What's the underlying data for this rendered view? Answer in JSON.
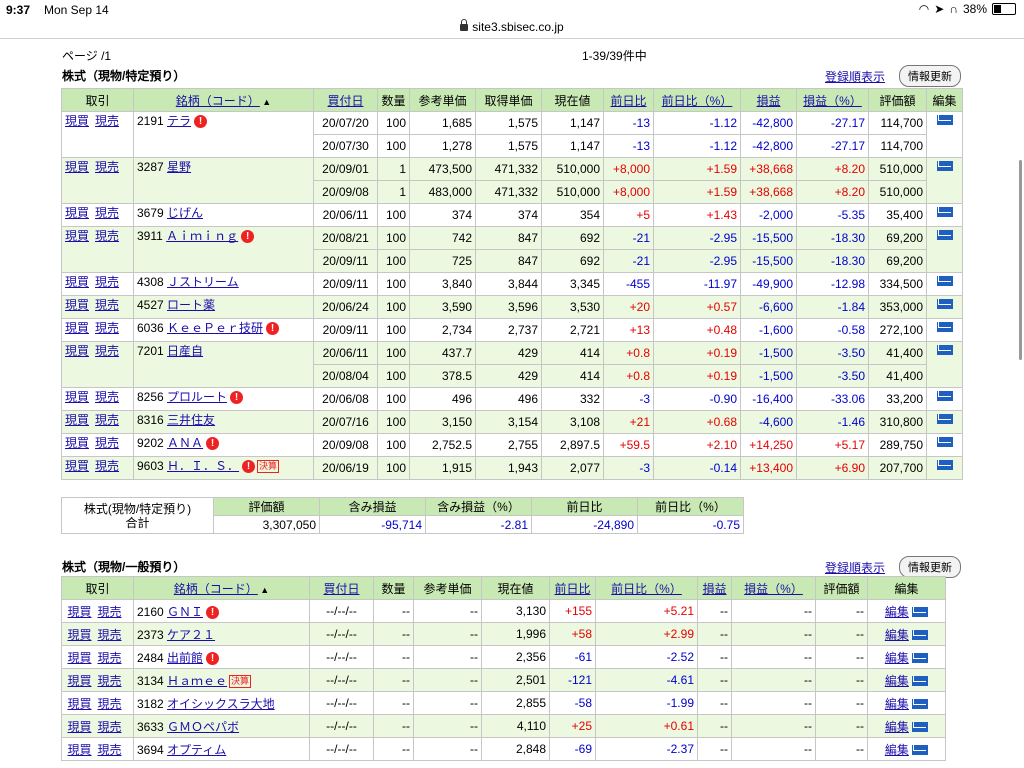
{
  "status": {
    "time": "9:37",
    "date": "Mon Sep 14",
    "battery": "38%"
  },
  "url": "site3.sbisec.co.jp",
  "page": {
    "label": "ページ /1",
    "count": "1-39/39件中"
  },
  "tools": {
    "sort_link": "登録順表示",
    "refresh_button": "情報更新"
  },
  "section1": {
    "title": "株式（現物/特定預り）",
    "headers": [
      "取引",
      "銘柄（コード）",
      "買付日",
      "数量",
      "参考単価",
      "取得単価",
      "現在値",
      "前日比",
      "前日比（%）",
      "損益",
      "損益（%）",
      "評価額",
      "編集"
    ],
    "buy": "現買",
    "sell": "現売",
    "rows": [
      {
        "code": "2191",
        "name": "テラ",
        "badge": "warn",
        "lots": [
          {
            "date": "20/07/20",
            "qty": "100",
            "ref": "1,685",
            "cost": "1,575",
            "price": "1,147",
            "chg": "-13",
            "chgp": "-1.12",
            "pl": "-42,800",
            "plp": "-27.17",
            "val": "114,700"
          },
          {
            "date": "20/07/30",
            "qty": "100",
            "ref": "1,278",
            "cost": "1,575",
            "price": "1,147",
            "chg": "-13",
            "chgp": "-1.12",
            "pl": "-42,800",
            "plp": "-27.17",
            "val": "114,700"
          }
        ]
      },
      {
        "code": "3287",
        "name": "星野",
        "badge": "",
        "lots": [
          {
            "date": "20/09/01",
            "qty": "1",
            "ref": "473,500",
            "cost": "471,332",
            "price": "510,000",
            "chg": "+8,000",
            "chgp": "+1.59",
            "pl": "+38,668",
            "plp": "+8.20",
            "val": "510,000"
          },
          {
            "date": "20/09/08",
            "qty": "1",
            "ref": "483,000",
            "cost": "471,332",
            "price": "510,000",
            "chg": "+8,000",
            "chgp": "+1.59",
            "pl": "+38,668",
            "plp": "+8.20",
            "val": "510,000"
          }
        ]
      },
      {
        "code": "3679",
        "name": "じげん",
        "badge": "",
        "lots": [
          {
            "date": "20/06/11",
            "qty": "100",
            "ref": "374",
            "cost": "374",
            "price": "354",
            "chg": "+5",
            "chgp": "+1.43",
            "pl": "-2,000",
            "plp": "-5.35",
            "val": "35,400"
          }
        ]
      },
      {
        "code": "3911",
        "name": "Ａｉｍｉｎｇ",
        "badge": "warn",
        "lots": [
          {
            "date": "20/08/21",
            "qty": "100",
            "ref": "742",
            "cost": "847",
            "price": "692",
            "chg": "-21",
            "chgp": "-2.95",
            "pl": "-15,500",
            "plp": "-18.30",
            "val": "69,200"
          },
          {
            "date": "20/09/11",
            "qty": "100",
            "ref": "725",
            "cost": "847",
            "price": "692",
            "chg": "-21",
            "chgp": "-2.95",
            "pl": "-15,500",
            "plp": "-18.30",
            "val": "69,200"
          }
        ]
      },
      {
        "code": "4308",
        "name": "Ｊストリーム",
        "badge": "",
        "lots": [
          {
            "date": "20/09/11",
            "qty": "100",
            "ref": "3,840",
            "cost": "3,844",
            "price": "3,345",
            "chg": "-455",
            "chgp": "-11.97",
            "pl": "-49,900",
            "plp": "-12.98",
            "val": "334,500"
          }
        ]
      },
      {
        "code": "4527",
        "name": "ロート薬",
        "badge": "",
        "lots": [
          {
            "date": "20/06/24",
            "qty": "100",
            "ref": "3,590",
            "cost": "3,596",
            "price": "3,530",
            "chg": "+20",
            "chgp": "+0.57",
            "pl": "-6,600",
            "plp": "-1.84",
            "val": "353,000"
          }
        ]
      },
      {
        "code": "6036",
        "name": "ＫｅｅＰｅｒ技研",
        "badge": "warn",
        "lots": [
          {
            "date": "20/09/11",
            "qty": "100",
            "ref": "2,734",
            "cost": "2,737",
            "price": "2,721",
            "chg": "+13",
            "chgp": "+0.48",
            "pl": "-1,600",
            "plp": "-0.58",
            "val": "272,100"
          }
        ]
      },
      {
        "code": "7201",
        "name": "日産自",
        "badge": "",
        "lots": [
          {
            "date": "20/06/11",
            "qty": "100",
            "ref": "437.7",
            "cost": "429",
            "price": "414",
            "chg": "+0.8",
            "chgp": "+0.19",
            "pl": "-1,500",
            "plp": "-3.50",
            "val": "41,400"
          },
          {
            "date": "20/08/04",
            "qty": "100",
            "ref": "378.5",
            "cost": "429",
            "price": "414",
            "chg": "+0.8",
            "chgp": "+0.19",
            "pl": "-1,500",
            "plp": "-3.50",
            "val": "41,400"
          }
        ]
      },
      {
        "code": "8256",
        "name": "プロルート",
        "badge": "warn",
        "lots": [
          {
            "date": "20/06/08",
            "qty": "100",
            "ref": "496",
            "cost": "496",
            "price": "332",
            "chg": "-3",
            "chgp": "-0.90",
            "pl": "-16,400",
            "plp": "-33.06",
            "val": "33,200"
          }
        ]
      },
      {
        "code": "8316",
        "name": "三井住友",
        "badge": "",
        "lots": [
          {
            "date": "20/07/16",
            "qty": "100",
            "ref": "3,150",
            "cost": "3,154",
            "price": "3,108",
            "chg": "+21",
            "chgp": "+0.68",
            "pl": "-4,600",
            "plp": "-1.46",
            "val": "310,800"
          }
        ]
      },
      {
        "code": "9202",
        "name": "ＡＮＡ",
        "badge": "warn",
        "lots": [
          {
            "date": "20/09/08",
            "qty": "100",
            "ref": "2,752.5",
            "cost": "2,755",
            "price": "2,897.5",
            "chg": "+59.5",
            "chgp": "+2.10",
            "pl": "+14,250",
            "plp": "+5.17",
            "val": "289,750"
          }
        ]
      },
      {
        "code": "9603",
        "name": "Ｈ．Ｉ．Ｓ．",
        "badge": "warn-kessan",
        "lots": [
          {
            "date": "20/06/19",
            "qty": "100",
            "ref": "1,915",
            "cost": "1,943",
            "price": "2,077",
            "chg": "-3",
            "chgp": "-0.14",
            "pl": "+13,400",
            "plp": "+6.90",
            "val": "207,700"
          }
        ]
      }
    ]
  },
  "summary": {
    "label": "株式(現物/特定預り)\n合計",
    "headers": [
      "評価額",
      "含み損益",
      "含み損益（%）",
      "前日比",
      "前日比（%）"
    ],
    "values": [
      "3,307,050",
      "-95,714",
      "-2.81",
      "-24,890",
      "-0.75"
    ]
  },
  "section2": {
    "title": "株式（現物/一般預り）",
    "headers": [
      "取引",
      "銘柄（コード）",
      "買付日",
      "数量",
      "参考単価",
      "現在値",
      "前日比",
      "前日比（%）",
      "損益",
      "損益（%）",
      "評価額",
      "編集"
    ],
    "edit_label": "編集",
    "rows": [
      {
        "code": "2160",
        "name": "ＧＮＩ",
        "badge": "warn",
        "date": "--/--/--",
        "qty": "--",
        "ref": "--",
        "price": "3,130",
        "chg": "+155",
        "chgp": "+5.21",
        "pl": "--",
        "plp": "--",
        "val": "--"
      },
      {
        "code": "2373",
        "name": "ケア２１",
        "badge": "",
        "date": "--/--/--",
        "qty": "--",
        "ref": "--",
        "price": "1,996",
        "chg": "+58",
        "chgp": "+2.99",
        "pl": "--",
        "plp": "--",
        "val": "--"
      },
      {
        "code": "2484",
        "name": "出前館",
        "badge": "warn",
        "date": "--/--/--",
        "qty": "--",
        "ref": "--",
        "price": "2,356",
        "chg": "-61",
        "chgp": "-2.52",
        "pl": "--",
        "plp": "--",
        "val": "--"
      },
      {
        "code": "3134",
        "name": "Ｈａｍｅｅ",
        "badge": "kessan",
        "date": "--/--/--",
        "qty": "--",
        "ref": "--",
        "price": "2,501",
        "chg": "-121",
        "chgp": "-4.61",
        "pl": "--",
        "plp": "--",
        "val": "--"
      },
      {
        "code": "3182",
        "name": "オイシックスラ大地",
        "badge": "",
        "date": "--/--/--",
        "qty": "--",
        "ref": "--",
        "price": "2,855",
        "chg": "-58",
        "chgp": "-1.99",
        "pl": "--",
        "plp": "--",
        "val": "--"
      },
      {
        "code": "3633",
        "name": "ＧＭＯペパボ",
        "badge": "",
        "date": "--/--/--",
        "qty": "--",
        "ref": "--",
        "price": "4,110",
        "chg": "+25",
        "chgp": "+0.61",
        "pl": "--",
        "plp": "--",
        "val": "--"
      },
      {
        "code": "3694",
        "name": "オプティム",
        "badge": "",
        "date": "--/--/--",
        "qty": "--",
        "ref": "--",
        "price": "2,848",
        "chg": "-69",
        "chgp": "-2.37",
        "pl": "--",
        "plp": "--",
        "val": "--"
      }
    ]
  },
  "badges": {
    "warn": "!",
    "kessan": "決算"
  }
}
